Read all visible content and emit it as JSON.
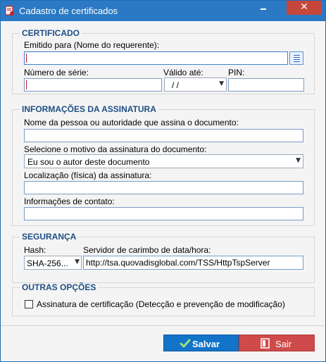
{
  "window": {
    "title": "Cadastro de certificados",
    "minimize_symbol": "",
    "close_symbol": "✕",
    "app_icon": "certificate-app-icon"
  },
  "certificado": {
    "legend": "CERTIFICADO",
    "emitido_label": "Emitido para (Nome do requerente):",
    "emitido_value": "",
    "lookup_icon": "list-lookup-icon",
    "serie_label": "Número de série:",
    "serie_value": "",
    "valido_label": "Válido até:",
    "valido_value": " /  /",
    "pin_label": "PIN:",
    "pin_value": ""
  },
  "assinatura": {
    "legend": "INFORMAÇÕES DA ASSINATURA",
    "nome_label": "Nome da pessoa ou autoridade que assina o documento:",
    "nome_value": "",
    "motivo_label": "Selecione o motivo da assinatura do documento:",
    "motivo_value": "Eu sou o autor deste documento",
    "localizacao_label": "Localização (física) da assinatura:",
    "localizacao_value": "",
    "contato_label": "Informações de contato:",
    "contato_value": ""
  },
  "seguranca": {
    "legend": "SEGURANÇA",
    "hash_label": "Hash:",
    "hash_value": "SHA-256...",
    "servidor_label": "Servidor de carimbo de data/hora:",
    "servidor_value": "http://tsa.quovadisglobal.com/TSS/HttpTspServer"
  },
  "outras": {
    "legend": "OUTRAS OPÇÕES",
    "checkbox_label": "Assinatura de certificação (Detecção e prevenção de modificação)",
    "checkbox_checked": false
  },
  "buttons": {
    "save_label": "Salvar",
    "exit_label": "Sair"
  },
  "colors": {
    "titlebar": "#2b79c4",
    "close": "#c7463b",
    "legend_text": "#1f4f86",
    "save_button": "#1273c8",
    "exit_button": "#cf4a4a"
  }
}
